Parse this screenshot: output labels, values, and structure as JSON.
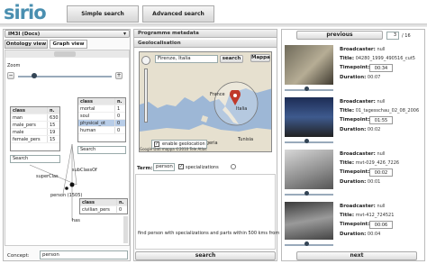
{
  "app": {
    "logo": "sirio"
  },
  "tabs": [
    {
      "label": "Simple search"
    },
    {
      "label": "Advanced search"
    }
  ],
  "left": {
    "dataset_select": "IM3I (Docs)",
    "view_tabs": [
      {
        "label": "Ontology view"
      },
      {
        "label": "Graph view"
      }
    ],
    "zoom_label": "Zoom",
    "table_a": {
      "headers": [
        "class",
        "n."
      ],
      "rows": [
        [
          "man",
          "630"
        ],
        [
          "male_pers",
          "15"
        ],
        [
          "male",
          "19"
        ],
        [
          "female_pers",
          "15"
        ]
      ]
    },
    "table_b": {
      "headers": [
        "class",
        "n."
      ],
      "rows": [
        [
          "mortal",
          "1"
        ],
        [
          "soul",
          "0"
        ],
        [
          "physical_ot",
          "0"
        ],
        [
          "human",
          "0"
        ]
      ]
    },
    "table_c": {
      "headers": [
        "class",
        "n."
      ],
      "rows": [
        [
          "civilian_pers",
          "0"
        ]
      ]
    },
    "search_a": "Search",
    "search_b": "Search",
    "node_labels": {
      "subclassof": "subClassOf",
      "superclass": "superClas",
      "person": "person (1505)",
      "has": "has"
    },
    "concept_label": "Concept:",
    "concept_value": "person"
  },
  "middle": {
    "title": "Programme metadata",
    "geo_title": "Geolocalisation",
    "map": {
      "search_value": "Firenze, Italia",
      "search_button": "search",
      "map_button": "Mappa",
      "countries": [
        "France",
        "Italia",
        "Algeria",
        "Tunisia"
      ],
      "enable_label": "enable geolocation",
      "footer": "Google   Dati mappa ©2010   Tele Atlas"
    },
    "term_label": "Term:",
    "term_value": "person",
    "specializations_label": "specializations",
    "query_text": "find person  with specializations and parts within 500 kms from",
    "search_button": "search"
  },
  "right": {
    "previous": "previous",
    "next": "next",
    "page": "3",
    "page_total": "/ 16",
    "results": [
      {
        "broadcaster_label": "Broadcaster:",
        "broadcaster": "null",
        "title_label": "Title:",
        "title": "04280_1999_490516_cut5",
        "timepoint_label": "Timepoint:",
        "timepoint": "00:34",
        "duration_label": "Duration:",
        "duration": "00:07"
      },
      {
        "broadcaster_label": "Broadcaster:",
        "broadcaster": "null",
        "title_label": "Title:",
        "title": "01_tagesschau_02_08_2006",
        "timepoint_label": "Timepoint:",
        "timepoint": "01:55",
        "duration_label": "Duration:",
        "duration": "00:02"
      },
      {
        "broadcaster_label": "Broadcaster:",
        "broadcaster": "null",
        "title_label": "Title:",
        "title": "mvt-029_426_7226",
        "timepoint_label": "Timepoint:",
        "timepoint": "00:02",
        "duration_label": "Duration:",
        "duration": "00:01"
      },
      {
        "broadcaster_label": "Broadcaster:",
        "broadcaster": "null",
        "title_label": "Title:",
        "title": "mvt-412_724521",
        "timepoint_label": "Timepoint:",
        "timepoint": "00:06",
        "duration_label": "Duration:",
        "duration": "00:04"
      }
    ]
  },
  "colors": {
    "logo": "#4a8fb0",
    "map_sea": "#9db7d6",
    "map_land": "#e6e0cf",
    "marker": "#c0392b"
  }
}
